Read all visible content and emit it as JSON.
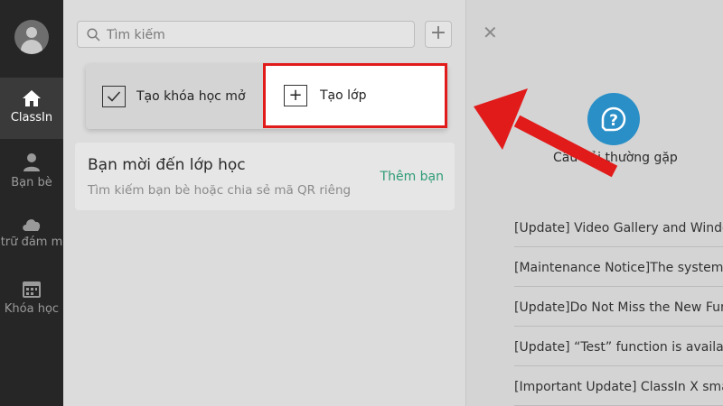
{
  "nav": {
    "items": [
      {
        "label": "ClassIn",
        "icon": "home-icon",
        "active": true
      },
      {
        "label": "Bạn bè",
        "icon": "person-icon",
        "active": false
      },
      {
        "label": "trữ đám m",
        "icon": "cloud-icon",
        "active": false
      },
      {
        "label": "Khóa học",
        "icon": "calendar-icon",
        "active": false
      }
    ]
  },
  "search": {
    "placeholder": "Tìm kiếm"
  },
  "popup": {
    "create_course_label": "Tạo khóa học mở",
    "create_class_label": "Tạo lớp"
  },
  "invite": {
    "title": "Bạn mời đến lớp học",
    "subtitle": "Tìm kiếm bạn bè hoặc chia sẻ mã QR riêng",
    "action_label": "Thêm bạn"
  },
  "help": {
    "label": "Câu hỏi thường gặp"
  },
  "news": [
    "[Update] Video Gallery and Windo",
    "[Maintenance Notice]The system w",
    "[Update]Do Not Miss the New Fun",
    "[Update] “Test” function is availa",
    "[Important Update] ClassIn X smar"
  ],
  "colors": {
    "highlight": "#e11a1a",
    "accent_green": "#2e9b77",
    "help_blue": "#2a8fc7",
    "nav_bg": "#262626"
  }
}
